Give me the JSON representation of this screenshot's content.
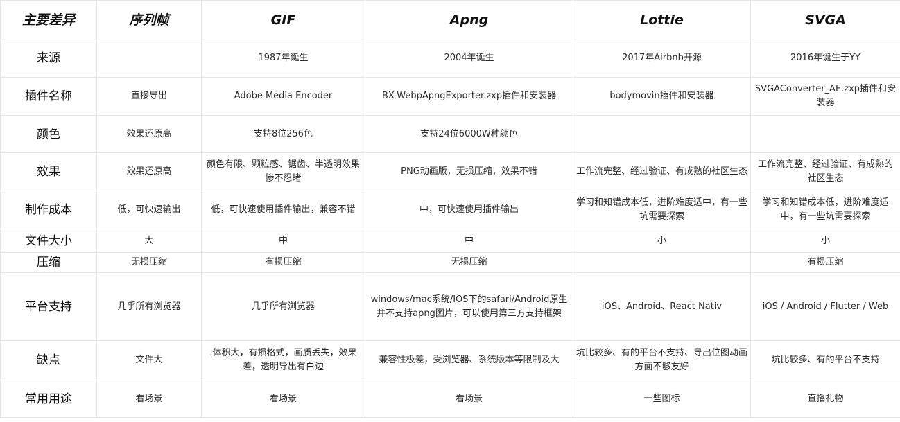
{
  "columns": [
    "主要差异",
    "序列帧",
    "GIF",
    "Apng",
    "Lottie",
    "SVGA"
  ],
  "rows": [
    {
      "label": "来源",
      "cells": [
        "",
        "1987年诞生",
        "2004年诞生",
        "2017年Airbnb开源",
        "2016年诞生于YY"
      ]
    },
    {
      "label": "插件名称",
      "cells": [
        "直接导出",
        "Adobe Media Encoder",
        "BX-WebpApngExporter.zxp插件和安装器",
        "bodymovin插件和安装器",
        "SVGAConverter_AE.zxp插件和安装器"
      ]
    },
    {
      "label": "颜色",
      "cells": [
        "效果还原高",
        "支持8位256色",
        "支持24位6000W种颜色",
        "",
        ""
      ]
    },
    {
      "label": "效果",
      "cells": [
        "效果还原高",
        "颜色有限、颗粒感、锯齿、半透明效果惨不忍睹",
        "PNG动画版，无损压缩，效果不错",
        "工作流完整、经过验证、有成熟的社区生态",
        "工作流完整、经过验证、有成熟的社区生态"
      ]
    },
    {
      "label": "制作成本",
      "cells": [
        "低，可快速输出",
        "低，可快速使用插件输出，兼容不错",
        "中，可快速使用插件输出",
        "学习和知错成本低，进阶难度适中，有一些坑需要探索",
        "学习和知错成本低，进阶难度适中，有一些坑需要探索"
      ]
    },
    {
      "label": "文件大小",
      "cells": [
        "大",
        "中",
        "中",
        "小",
        "小"
      ]
    },
    {
      "label": "压缩",
      "cells": [
        "无损压缩",
        "有损压缩",
        "无损压缩",
        "",
        "有损压缩"
      ]
    },
    {
      "label": "平台支持",
      "cells": [
        "几乎所有浏览器",
        "几乎所有浏览器",
        "windows/mac系统/IOS下的safari/Android原生并不支持apng图片，可以使用第三方支持框架",
        "iOS、Android、React Nativ",
        "iOS / Android / Flutter / Web"
      ]
    },
    {
      "label": "缺点",
      "cells": [
        "文件大",
        ".体积大，有损格式，画质丢失，效果差，透明导出有白边",
        "兼容性极差，受浏览器、系统版本等限制及大",
        "坑比较多、有的平台不支持、导出位图动画方面不够友好",
        "坑比较多、有的平台不支持"
      ]
    },
    {
      "label": "常用用途",
      "cells": [
        "看场景",
        "看场景",
        "看场景",
        "一些图标",
        "直播礼物"
      ]
    }
  ]
}
